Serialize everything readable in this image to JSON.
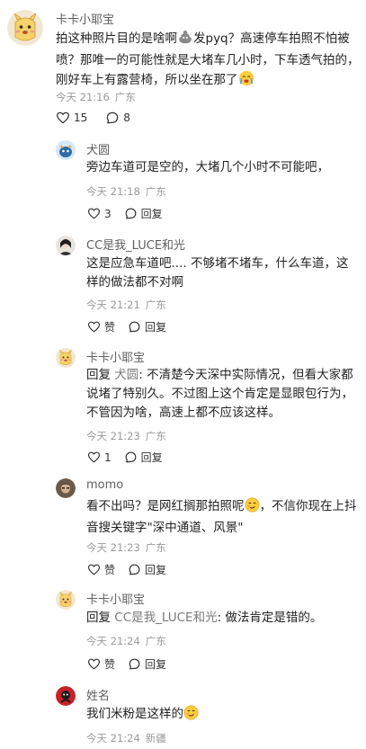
{
  "comments": [
    {
      "username": "卡卡小耶宝",
      "text": "拍这种照片目的是啥啊",
      "text2": "发pyq？高速停车拍照不怕被喷？那唯一的可能性就是大堵车几小时，下车透气拍的，刚好车上有露营椅，所以坐在那了",
      "time": "今天 21:16",
      "location": "广东",
      "likes": "15",
      "replies": "8",
      "emoji1": "poop-emoji",
      "emoji2": "crying-face-emoji"
    }
  ],
  "replies": [
    {
      "username": "犬圆",
      "text": "旁边车道可是空的，大堵几个小时不可能吧，",
      "time": "今天 21:18",
      "location": "广东",
      "likes": "3",
      "reply_label": "回复"
    },
    {
      "username": "CC是我_LUCE和光",
      "text": "这是应急车道吧.... 不够堵不堵车，什么车道，这样的做法都不对啊",
      "time": "今天 21:21",
      "location": "广东",
      "likes": "赞",
      "reply_label": "回复"
    },
    {
      "username": "卡卡小耶宝",
      "reply_prefix": "回复",
      "mention": "犬圆",
      "text": ": 不清楚今天深中实际情况，但看大家都说堵了特别久。不过图上这个肯定是显眼包行为，不管因为啥，高速上都不应该这样。",
      "time": "今天 21:23",
      "location": "广东",
      "likes": "1",
      "reply_label": "回复"
    },
    {
      "username": "momo",
      "text": "看不出吗？是网红搁那拍照呢",
      "text2": "，不信你现在上抖音搜关键字\"深中通道、风景\"",
      "time": "今天 21:23",
      "location": "广东",
      "likes": "赞",
      "reply_label": "回复",
      "emoji": "smirk-face-emoji"
    },
    {
      "username": "卡卡小耶宝",
      "reply_prefix": "回复",
      "mention": "CC是我_LUCE和光",
      "text": ": 做法肯定是错的。",
      "time": "今天 21:24",
      "location": "广东",
      "likes": "赞",
      "reply_label": "回复"
    },
    {
      "username": "姓名",
      "text": "我们米粉是这样的",
      "time": "今天 21:24",
      "location": "新疆",
      "emoji": "smirk-face-emoji"
    }
  ],
  "icons": {
    "heart": "heart-icon",
    "comment": "comment-bubble-icon"
  },
  "colors": {
    "text": "#222222",
    "secondary": "#9a9a9a",
    "name": "#5f5f5f"
  }
}
